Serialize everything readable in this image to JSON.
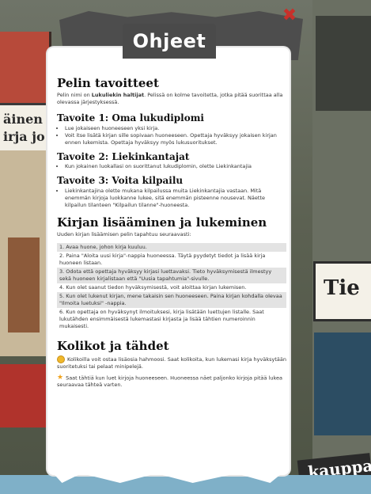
{
  "background": {
    "left_sign_lines": [
      "äinen t",
      "irja jo"
    ],
    "right_sign_text": "Tie",
    "shop_label": "kauppa"
  },
  "dialog": {
    "title": "Ohjeet",
    "close_glyph": "✖",
    "sections": {
      "goals": {
        "heading": "Pelin tavoitteet",
        "intro_prefix": "Pelin nimi on ",
        "intro_bold": "Lukuliekin haltijat",
        "intro_suffix": ". Pelissä on kolme tavoitetta, jotka pitää suorittaa alla olevassa järjestyksessä."
      },
      "goal1": {
        "heading": "Tavoite 1: Oma lukudiplomi",
        "items": [
          "Lue jokaiseen huoneeseen yksi kirja.",
          "Voit itse lisätä kirjan sille sopivaan huoneeseen. Opettaja hyväksyy jokaisen kirjan ennen lukemista. Opettaja hyväksyy myös lukusuoritukset."
        ]
      },
      "goal2": {
        "heading": "Tavoite 2: Liekinkantajat",
        "items": [
          "Kun jokainen luokallasi on suorittanut lukudiplomin, olette Liekinkantajia"
        ]
      },
      "goal3": {
        "heading": "Tavoite 3: Voita kilpailu",
        "items": [
          "Liekinkantajina olette mukana kilpailussa muita Liekinkantajia vastaan. Mitä enemmän kirjoja luokkanne lukee, sitä enemmän pisteenne nousevat. Näette kilpailun tilanteen \"Kilpailun tilanne\"-huoneesta."
        ]
      },
      "books": {
        "heading": "Kirjan lisääminen ja lukeminen",
        "intro": "Uuden kirjan lisäämisen pelin tapahtuu seuraavasti:",
        "steps": [
          "1. Avaa huone, johon kirja kuuluu.",
          "2. Paina \"Aloita uusi kirja\"-nappia huoneessa. Täytä pyydetyt tiedot ja lisää kirja huoneen listaan.",
          "3. Odota että opettaja hyväksyy kirjasi luettavaksi. Tieto hyväksymisestä ilmestyy sekä huoneen kirjalistaan että \"Uusia tapahtumia\"-sivulle.",
          "4. Kun olet saanut tiedon hyväksymisestä, voit aloittaa kirjan lukemisen.",
          "5. Kun olet lukenut kirjan, mene takaisin sen huoneeseen. Paina kirjan kohdalla olevaa \"Ilmoita luetuksi\" -nappia.",
          "6. Kun opettaja on hyväksynyt ilmoituksesi, kirja lisätään luettujen listalle. Saat lukutähden ensimmäisestä lukemastasi kirjasta ja lisää tähtien numeroinnin mukaisesti."
        ]
      },
      "coins": {
        "heading": "Kolikot ja tähdet",
        "coin_text": "Kolikoilla voit ostaa lisäosia hahmoosi. Saat kolikoita, kun lukemasi kirja hyväksytään suoritetuksi tai pelaat minipelejä.",
        "star_text": "Saat tähtiä kun luet kirjoja huoneeseen. Huoneessa näet paljonko kirjoja pitää lukea seuraavaa tähteä varten."
      }
    }
  },
  "colors": {
    "close": "#c8302a",
    "coin": "#f0b82b",
    "star": "#f0a21b",
    "title_tab": "#4a4a4a"
  }
}
